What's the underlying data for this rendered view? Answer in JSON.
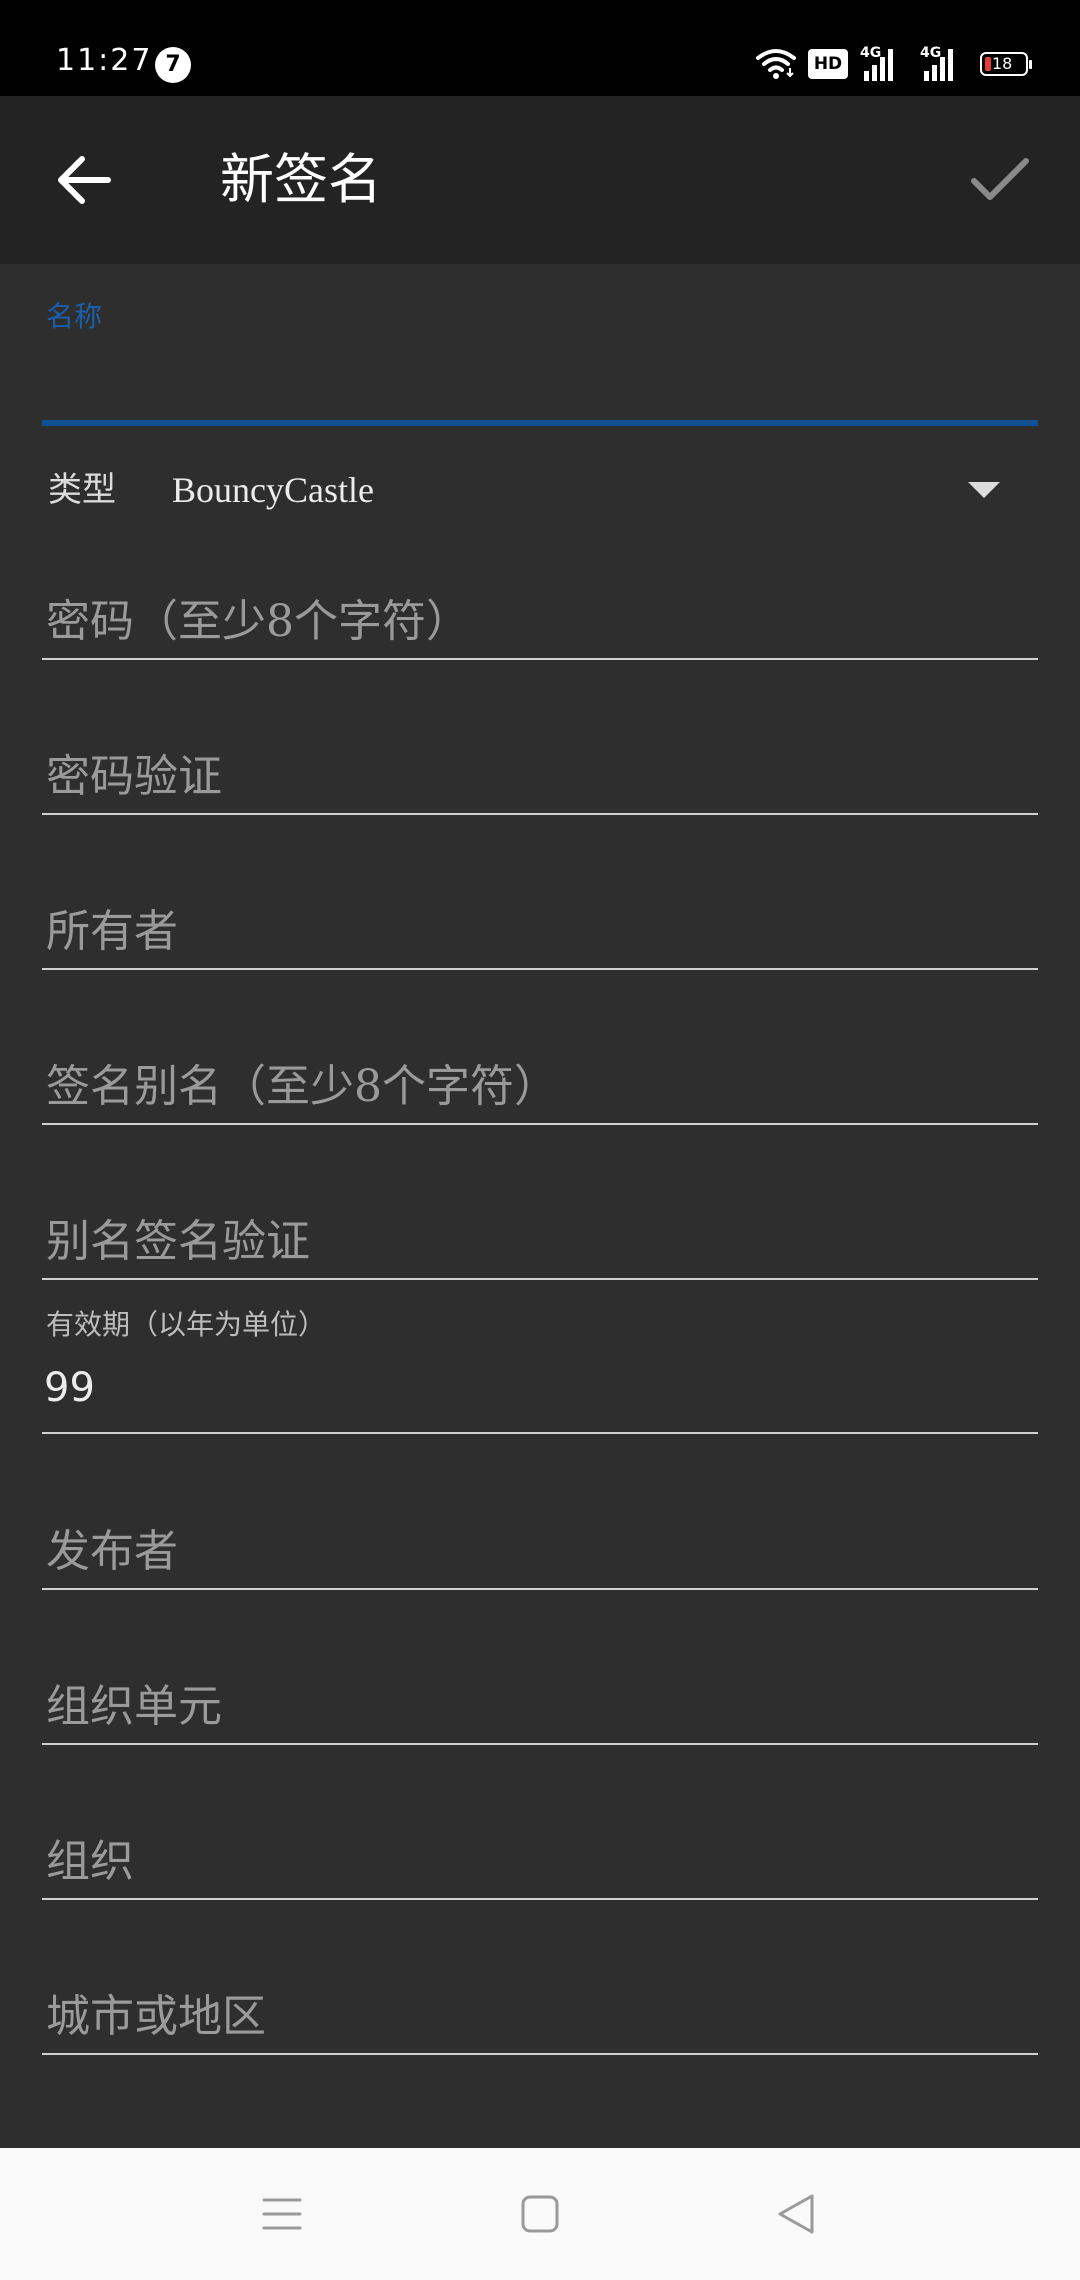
{
  "status_bar": {
    "time": "11:27",
    "notification_count": "7",
    "hd_label": "HD",
    "network_1": "4G",
    "network_2": "4G",
    "battery_level": "18"
  },
  "app_bar": {
    "title": "新签名",
    "back_icon": "arrow-left-icon",
    "confirm_icon": "check-icon"
  },
  "form": {
    "name": {
      "label": "名称",
      "value": ""
    },
    "type": {
      "label": "类型",
      "value": "BouncyCastle"
    },
    "password": {
      "placeholder": "密码（至少8个字符）"
    },
    "password_confirm": {
      "placeholder": "密码验证"
    },
    "owner": {
      "placeholder": "所有者"
    },
    "alias": {
      "placeholder": "签名别名（至少8个字符）"
    },
    "alias_confirm": {
      "placeholder": "别名签名验证"
    },
    "validity": {
      "label": "有效期（以年为单位）",
      "value": "99"
    },
    "issuer": {
      "placeholder": "发布者"
    },
    "org_unit": {
      "placeholder": "组织单元"
    },
    "organization": {
      "placeholder": "组织"
    },
    "city": {
      "placeholder": "城市或地区"
    }
  },
  "nav_bar": {
    "menu_icon": "menu-icon",
    "home_icon": "home-square-icon",
    "back_icon": "back-triangle-icon"
  },
  "colors": {
    "accent": "#0f4f94",
    "background": "#2e2e2e",
    "app_bar": "#232323"
  }
}
